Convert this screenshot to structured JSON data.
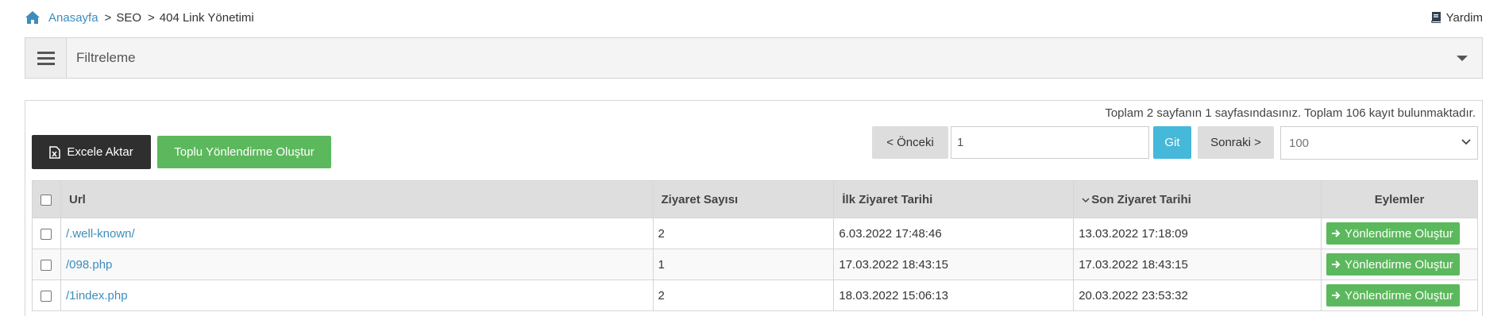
{
  "breadcrumb": {
    "home": "Anasayfa",
    "items": [
      "SEO",
      "404 Link Yönetimi"
    ],
    "separator": ">"
  },
  "help_label": "Yardim",
  "filter": {
    "title": "Filtreleme"
  },
  "summary": "Toplam 2 sayfanın 1 sayfasındasınız. Toplam 106 kayıt bulunmaktadır.",
  "toolbar": {
    "excel_label": "Excele Aktar",
    "bulk_label": "Toplu Yönlendirme Oluştur"
  },
  "pager": {
    "prev_label": "< Önceki",
    "page_value": "1",
    "go_label": "Git",
    "next_label": "Sonraki >",
    "page_size": "100"
  },
  "table": {
    "headers": {
      "url": "Url",
      "visits": "Ziyaret Sayısı",
      "first_visit": "İlk Ziyaret Tarihi",
      "last_visit": "Son Ziyaret Tarihi",
      "actions": "Eylemler"
    },
    "action_label": "Yönlendirme Oluştur",
    "rows": [
      {
        "url": "/.well-known/",
        "visits": "2",
        "first": "6.03.2022 17:48:46",
        "last": "13.03.2022 17:18:09"
      },
      {
        "url": "/098.php",
        "visits": "1",
        "first": "17.03.2022 18:43:15",
        "last": "17.03.2022 18:43:15"
      },
      {
        "url": "/1index.php",
        "visits": "2",
        "first": "18.03.2022 15:06:13",
        "last": "20.03.2022 23:53:32"
      }
    ]
  },
  "colors": {
    "link": "#3c8dbc",
    "success": "#5cb85c",
    "info": "#46b8da",
    "dark": "#2f2f2f"
  }
}
